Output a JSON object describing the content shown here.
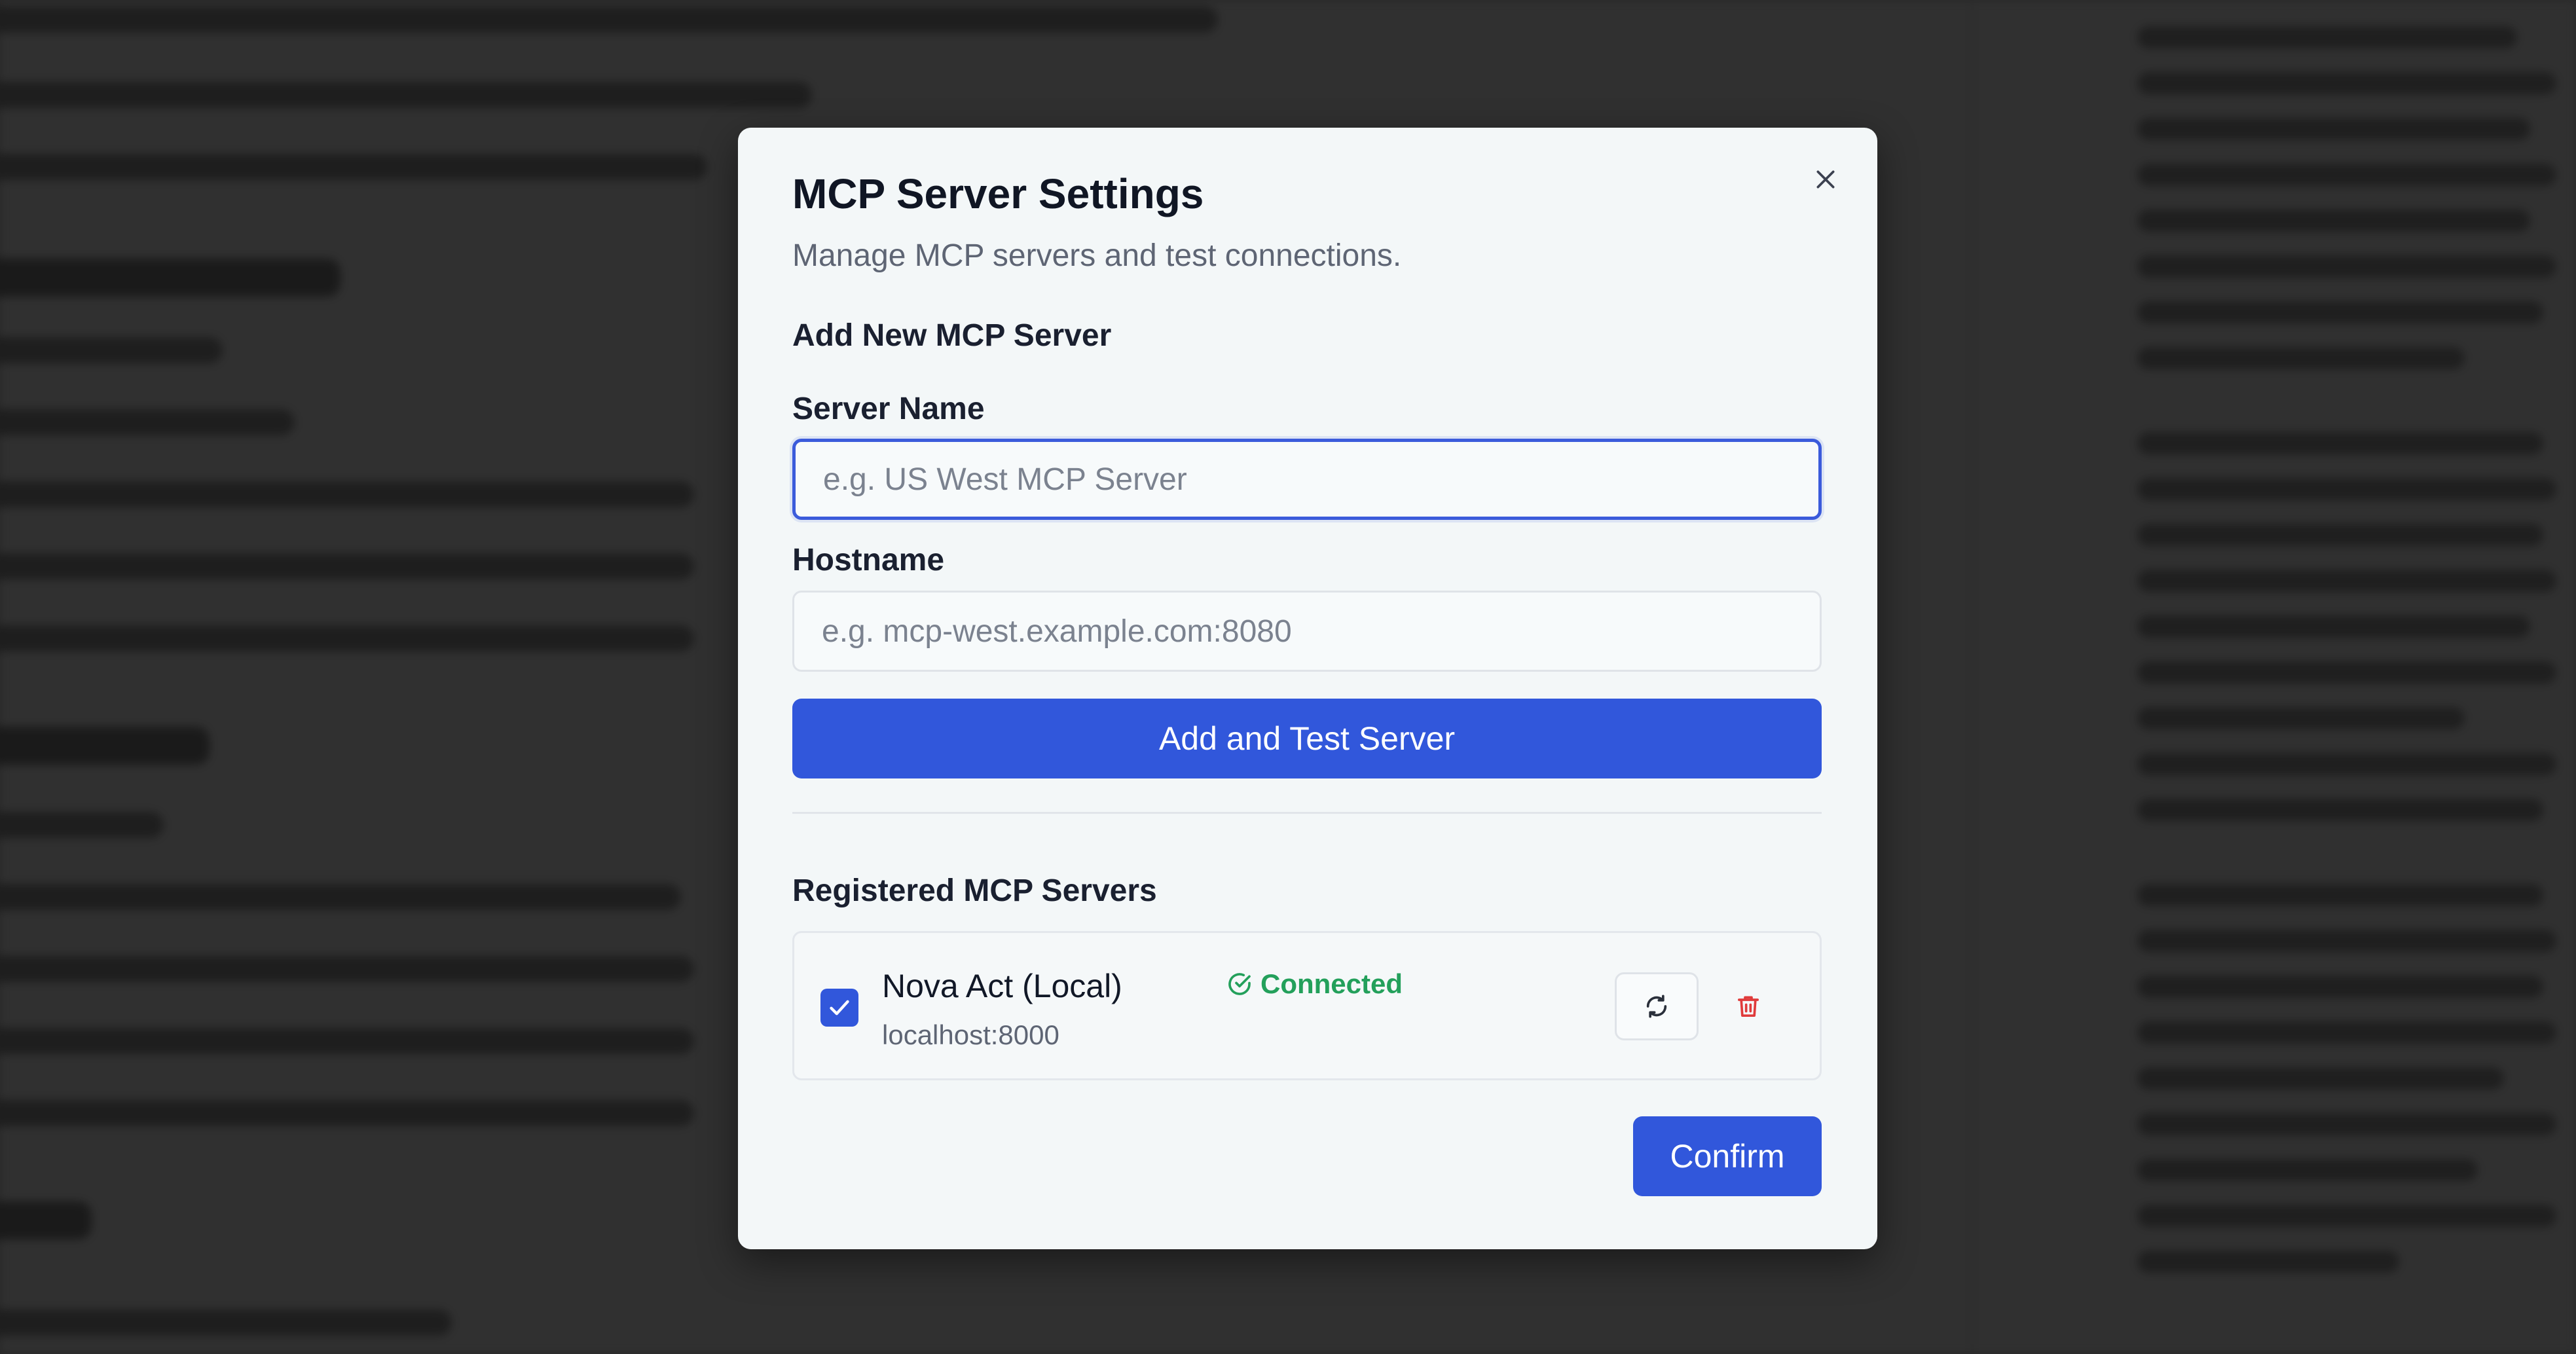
{
  "modal": {
    "title": "MCP Server Settings",
    "subtitle": "Manage MCP servers and test connections.",
    "add_section_heading": "Add New MCP Server",
    "server_name_label": "Server Name",
    "server_name_placeholder": "e.g. US West MCP Server",
    "server_name_value": "",
    "hostname_label": "Hostname",
    "hostname_placeholder": "e.g. mcp-west.example.com:8080",
    "hostname_value": "",
    "add_button_label": "Add and Test Server",
    "registered_heading": "Registered MCP Servers",
    "servers": [
      {
        "name": "Nova Act (Local)",
        "host": "localhost:8000",
        "status": "Connected",
        "selected": true
      }
    ],
    "confirm_label": "Confirm"
  },
  "icons": {
    "close": "close-icon",
    "checkbox": "checkmark-icon",
    "status": "check-circle-icon",
    "refresh": "refresh-icon",
    "delete": "trash-icon"
  },
  "colors": {
    "accent": "#3157db",
    "success": "#23a05b",
    "danger": "#e03b3b",
    "modal_bg": "#f3f7f8"
  }
}
